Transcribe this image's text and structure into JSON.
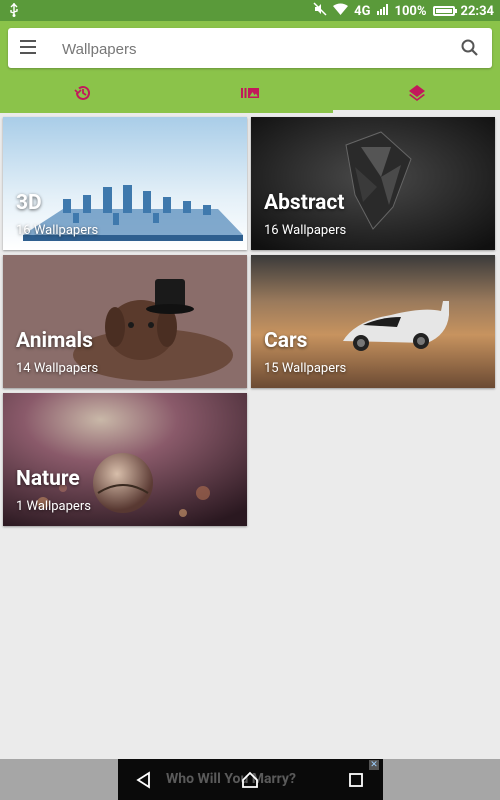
{
  "status_bar": {
    "network": "4G",
    "battery": "100%",
    "battery_level": 1.0,
    "time": "22:34"
  },
  "search": {
    "placeholder": "Wallpapers"
  },
  "tabs": [
    {
      "icon": "history-icon"
    },
    {
      "icon": "collections-icon"
    },
    {
      "icon": "layers-icon",
      "active": true
    }
  ],
  "categories": [
    {
      "title": "3D",
      "count": "16 Wallpapers"
    },
    {
      "title": "Abstract",
      "count": "16 Wallpapers"
    },
    {
      "title": "Animals",
      "count": "14 Wallpapers"
    },
    {
      "title": "Cars",
      "count": "15 Wallpapers"
    },
    {
      "title": "Nature",
      "count": "1 Wallpapers"
    }
  ],
  "ad": {
    "text": "Who Will You Marry?"
  },
  "colors": {
    "primary": "#8bc34a",
    "status_bar": "#5a9a3a",
    "accent": "#c2185b"
  }
}
